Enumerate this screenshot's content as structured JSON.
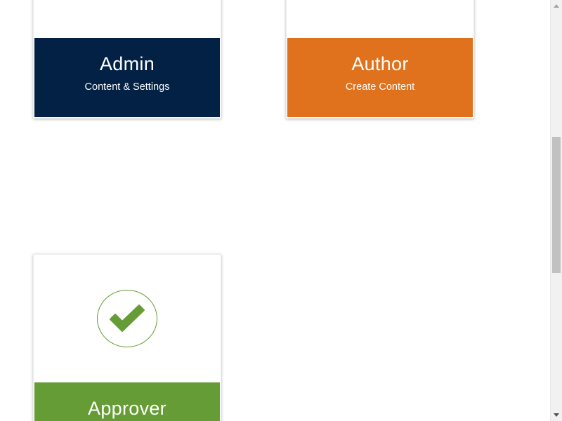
{
  "roles": [
    {
      "id": "admin",
      "title": "Admin",
      "subtitle": "Content & Settings",
      "color": "#022144",
      "icon": "user-circle-icon"
    },
    {
      "id": "author",
      "title": "Author",
      "subtitle": "Create Content",
      "color": "#e0711d",
      "icon": "pencil-circle-icon"
    },
    {
      "id": "approver",
      "title": "Approver",
      "subtitle": "",
      "color": "#659c35",
      "icon": "checkmark-icon"
    }
  ],
  "scrollbar": {
    "position_fraction": 0.33
  }
}
